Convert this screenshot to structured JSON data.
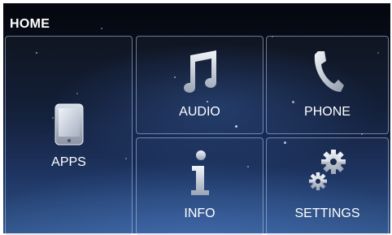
{
  "header": {
    "title": "HOME"
  },
  "tiles": [
    {
      "id": "apps",
      "label": "APPS",
      "icon": "tablet-icon"
    },
    {
      "id": "audio",
      "label": "AUDIO",
      "icon": "music-note-icon"
    },
    {
      "id": "phone",
      "label": "PHONE",
      "icon": "phone-handset-icon"
    },
    {
      "id": "info",
      "label": "INFO",
      "icon": "info-icon"
    },
    {
      "id": "settings",
      "label": "SETTINGS",
      "icon": "gears-icon"
    }
  ],
  "colors": {
    "text": "#ffffff",
    "background_top": "#05070d",
    "background_bottom": "#2a4f86",
    "tile_border": "#becde6"
  }
}
